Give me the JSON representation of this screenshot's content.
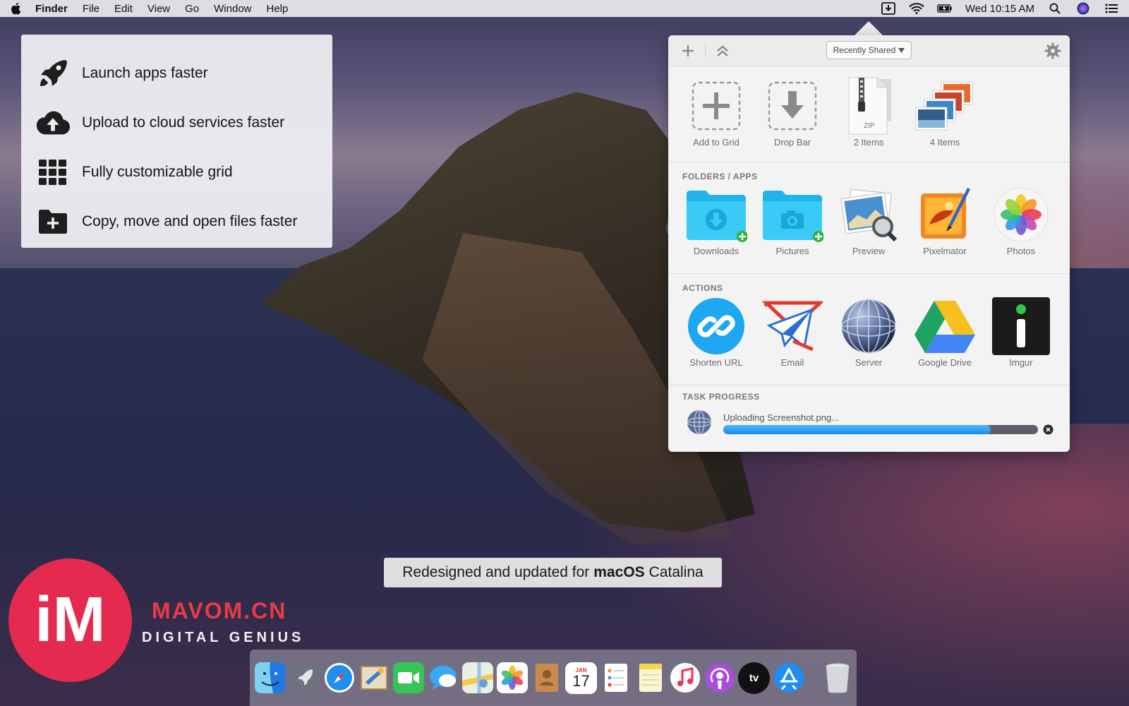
{
  "menubar": {
    "app_name": "Finder",
    "items": [
      "File",
      "Edit",
      "View",
      "Go",
      "Window",
      "Help"
    ],
    "clock": "Wed 10:15 AM"
  },
  "features": [
    {
      "icon": "rocket-icon",
      "text": "Launch apps faster"
    },
    {
      "icon": "cloud-upload-icon",
      "text": "Upload to cloud services faster"
    },
    {
      "icon": "grid-icon",
      "text": "Fully customizable grid"
    },
    {
      "icon": "folder-plus-icon",
      "text": "Copy, move and open files faster"
    }
  ],
  "panel": {
    "dropdown_label": "Recently Shared",
    "top_row": [
      {
        "label": "Add to Grid",
        "icon": "add-icon"
      },
      {
        "label": "Drop Bar",
        "icon": "drop-bar-icon"
      },
      {
        "label": "2 Items",
        "icon": "zip-file-icon",
        "badge": "ZIP"
      },
      {
        "label": "4 Items",
        "icon": "image-stack-icon"
      }
    ],
    "folders_title": "FOLDERS / APPS",
    "folders": [
      {
        "label": "Downloads",
        "icon": "downloads-folder-icon"
      },
      {
        "label": "Pictures",
        "icon": "pictures-folder-icon"
      },
      {
        "label": "Preview",
        "icon": "preview-app-icon"
      },
      {
        "label": "Pixelmator",
        "icon": "pixelmator-app-icon"
      },
      {
        "label": "Photos",
        "icon": "photos-app-icon"
      }
    ],
    "actions_title": "ACTIONS",
    "actions": [
      {
        "label": "Shorten URL",
        "icon": "link-icon"
      },
      {
        "label": "Email",
        "icon": "mail-plane-icon"
      },
      {
        "label": "Server",
        "icon": "server-globe-icon"
      },
      {
        "label": "Google Drive",
        "icon": "google-drive-icon"
      },
      {
        "label": "Imgur",
        "icon": "imgur-icon"
      }
    ],
    "task_title": "TASK PROGRESS",
    "task_text": "Uploading Screenshot.png...",
    "task_progress": 0.85
  },
  "caption": {
    "prefix": "Redesigned and updated for",
    "emphasis": "macOS",
    "suffix": "Catalina"
  },
  "watermark": {
    "logo": "iM",
    "site": "MAVOM.CN",
    "tagline": "DIGITAL GENIUS"
  },
  "dock": {
    "calendar_month": "JAN",
    "calendar_day": "17",
    "tv_label": "tv"
  },
  "colors": {
    "accent_blue": "#1a8cf0",
    "watermark_red": "#e42a4f",
    "folder_cyan": "#29c6f5"
  }
}
